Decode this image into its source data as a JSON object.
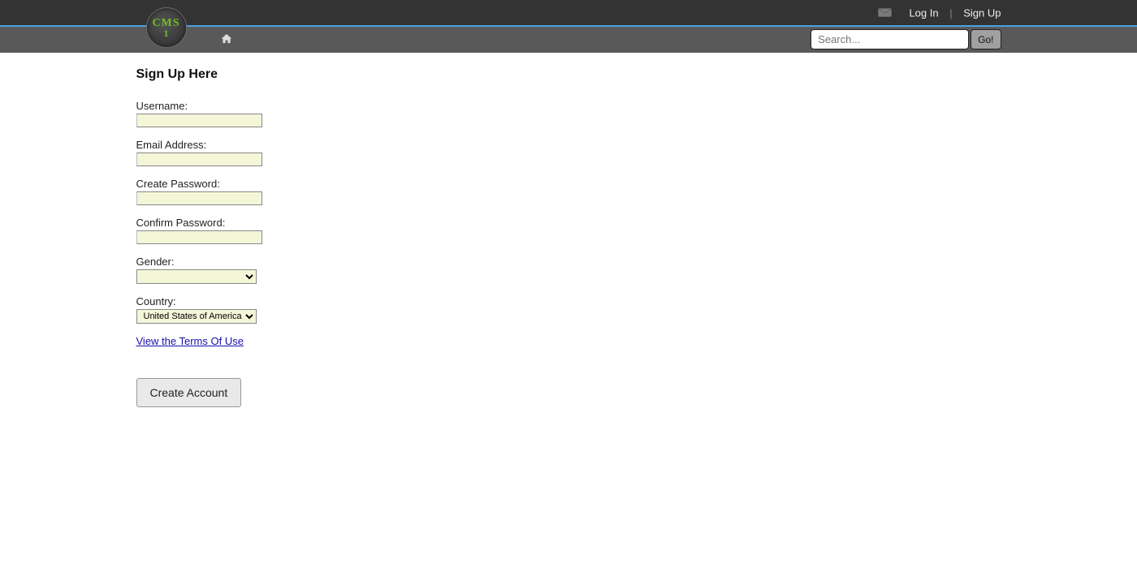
{
  "header": {
    "logo_top": "CMS",
    "logo_bottom": "1",
    "login_label": "Log In",
    "signup_label": "Sign Up",
    "search_placeholder": "Search...",
    "go_label": "Go!"
  },
  "page": {
    "title": "Sign Up Here"
  },
  "form": {
    "username_label": "Username:",
    "username_value": "",
    "email_label": "Email Address:",
    "email_value": "",
    "password_label": "Create Password:",
    "password_value": "",
    "confirm_label": "Confirm Password:",
    "confirm_value": "",
    "gender_label": "Gender:",
    "gender_value": "",
    "country_label": "Country:",
    "country_value": "United States of America",
    "tos_label": "View the Terms Of Use",
    "submit_label": "Create Account"
  }
}
